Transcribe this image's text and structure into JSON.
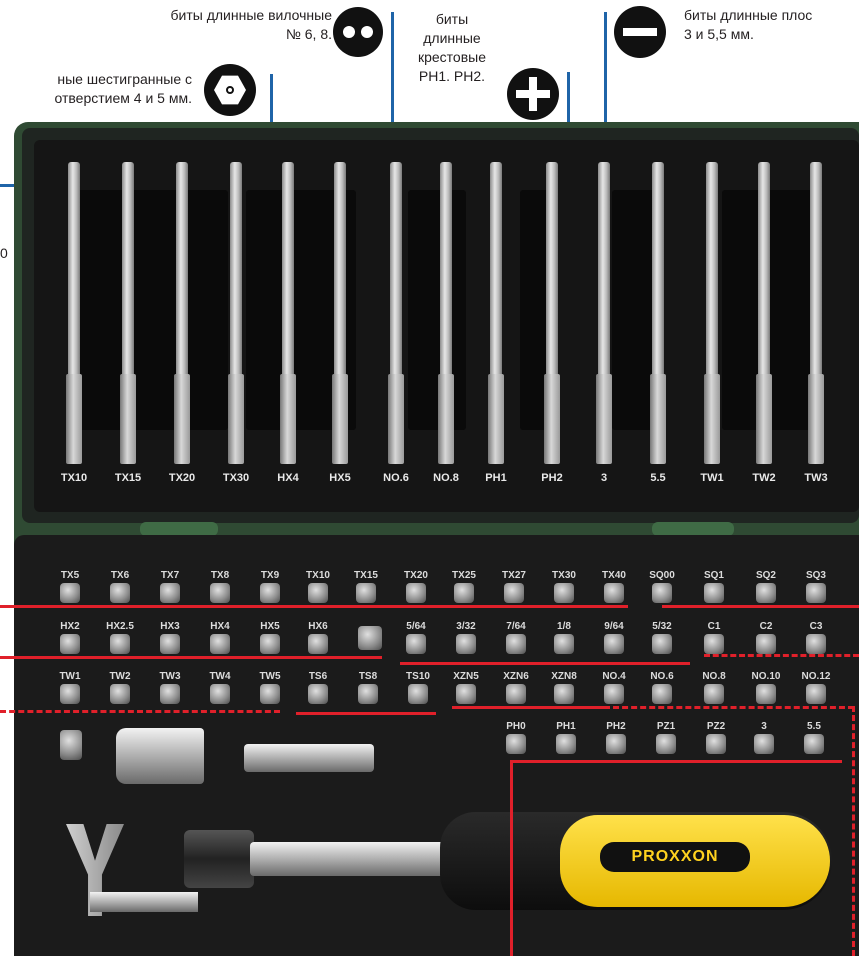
{
  "captions": {
    "fork": {
      "line1": "биты длинные вилочные",
      "line2": "№ 6, 8."
    },
    "hex": {
      "line1": "ные шестигранные с",
      "line2": "отверстием 4 и 5 мм."
    },
    "phillips": {
      "line1": "биты",
      "line2": "длинные",
      "line3": "крестовые",
      "line4": "PH1. PH2."
    },
    "flat": {
      "line1": "биты длинные плос",
      "line2": "3 и 5,5 мм."
    },
    "left_fragment": "0"
  },
  "long_bits": [
    "TX10",
    "TX15",
    "TX20",
    "TX30",
    "HX4",
    "HX5",
    "NO.6",
    "NO.8",
    "PH1",
    "PH2",
    "3",
    "5.5",
    "TW1",
    "TW2",
    "TW3"
  ],
  "row1": [
    "TX5",
    "TX6",
    "TX7",
    "TX8",
    "TX9",
    "TX10",
    "TX15",
    "TX20",
    "TX25",
    "TX27",
    "TX30",
    "TX40",
    "SQ00",
    "SQ1",
    "SQ2",
    "SQ3"
  ],
  "row2": [
    "HX2",
    "HX2.5",
    "HX3",
    "HX4",
    "HX5",
    "HX6",
    "",
    "5/64",
    "3/32",
    "7/64",
    "1/8",
    "9/64",
    "5/32",
    "C1",
    "C2",
    "C3"
  ],
  "row3": [
    "TW1",
    "TW2",
    "TW3",
    "TW4",
    "TW5",
    "TS6",
    "TS8",
    "TS10",
    "XZN5",
    "XZN6",
    "XZN8",
    "NO.4",
    "NO.6",
    "NO.8",
    "NO.10",
    "NO.12"
  ],
  "row4": [
    "PH0",
    "PH1",
    "PH2",
    "PZ1",
    "PZ2",
    "3",
    "5.5"
  ],
  "brand": "PROXXON",
  "colors": {
    "accent_red": "#e0202a",
    "accent_blue": "#1f64a8",
    "case_green": "#2f4a33",
    "handle_yellow": "#f2c200"
  }
}
